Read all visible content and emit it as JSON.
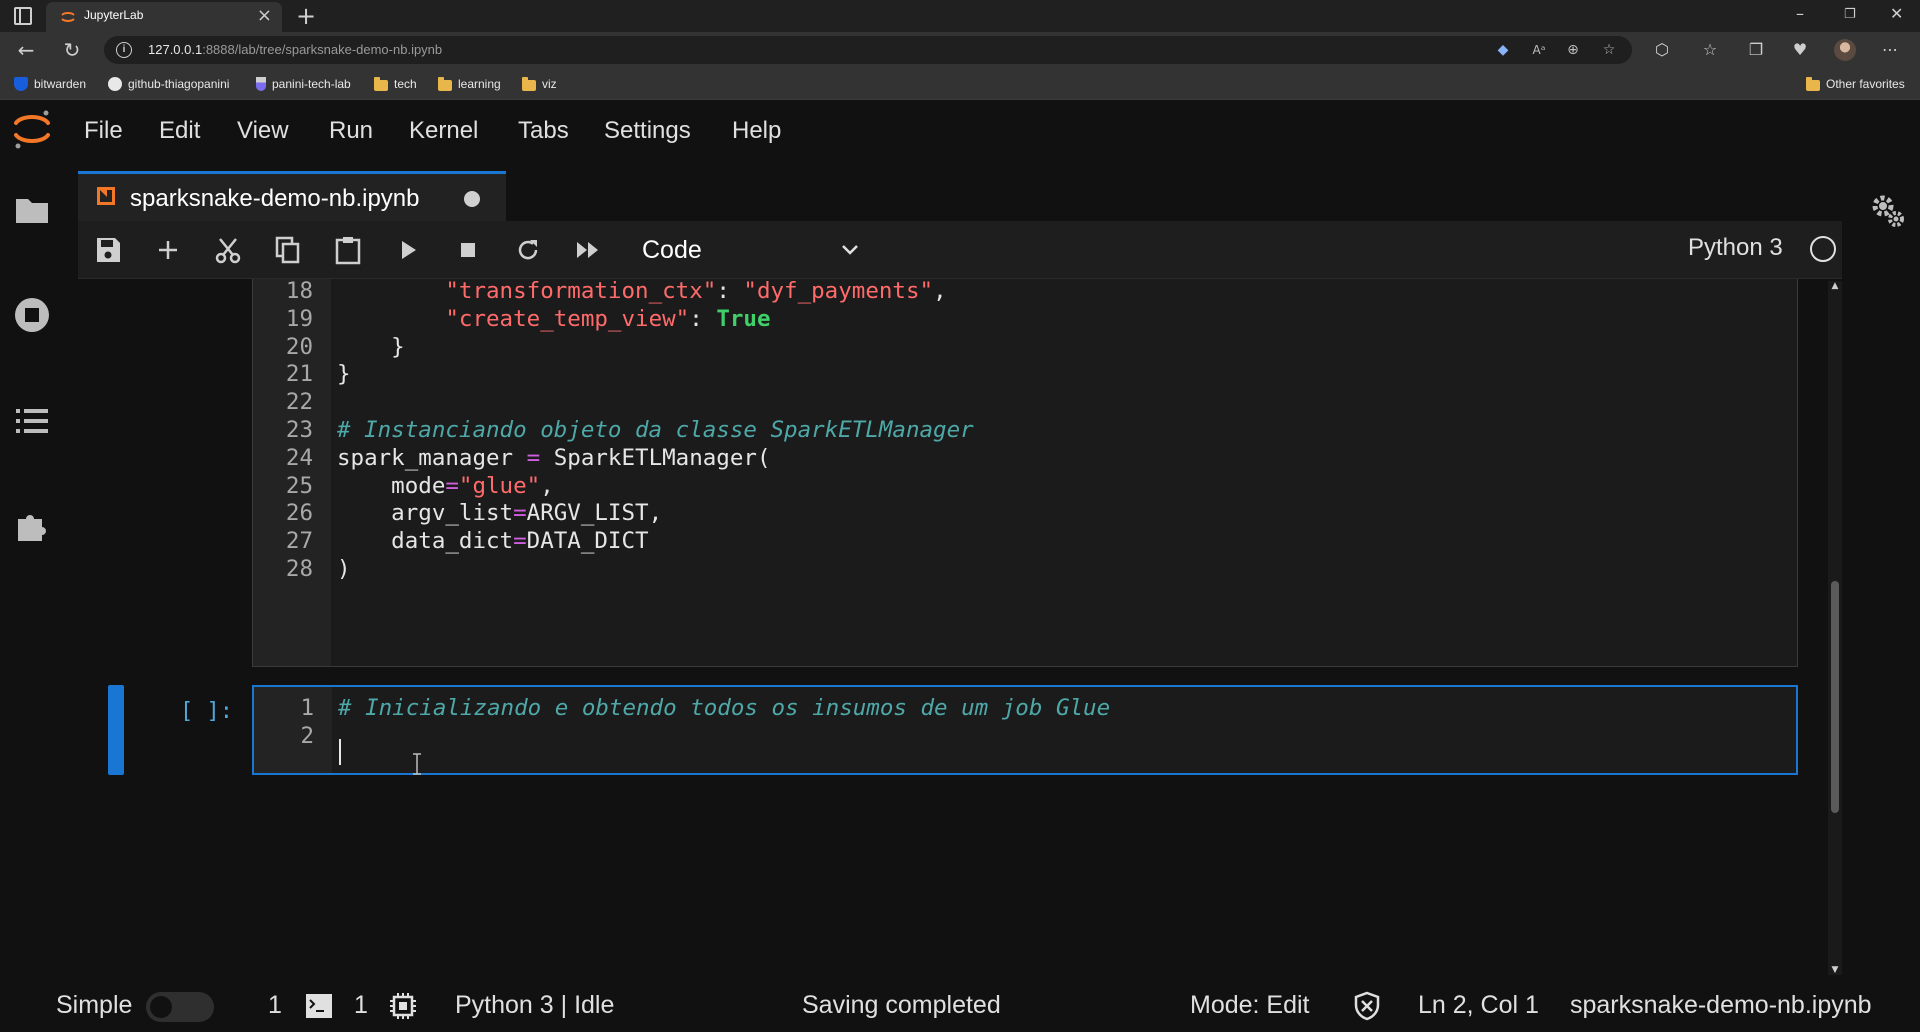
{
  "browser": {
    "tab_title": "JupyterLab",
    "url_host": "127.0.0.1",
    "url_rest": ":8888/lab/tree/sparksnake-demo-nb.ipynb",
    "bookmarks": [
      {
        "label": "bitwarden",
        "icon": "shield-icon"
      },
      {
        "label": "github-thiagopanini",
        "icon": "github-icon"
      },
      {
        "label": "panini-tech-lab",
        "icon": "flask-icon"
      },
      {
        "label": "tech",
        "icon": "folder-icon"
      },
      {
        "label": "learning",
        "icon": "folder-icon"
      },
      {
        "label": "viz",
        "icon": "folder-icon"
      }
    ],
    "other_favorites": "Other favorites"
  },
  "menu": [
    "File",
    "Edit",
    "View",
    "Run",
    "Kernel",
    "Tabs",
    "Settings",
    "Help"
  ],
  "document": {
    "tab_title": "sparksnake-demo-nb.ipynb",
    "unsaved_dot_color": "#d0d0d0"
  },
  "toolbar": {
    "cell_type": "Code",
    "kernel_name": "Python 3"
  },
  "cells": {
    "previous": {
      "lines": [
        {
          "n": "18",
          "tokens": [
            {
              "t": "        ",
              "c": "plain"
            },
            {
              "t": "\"transformation_ctx\"",
              "c": "str"
            },
            {
              "t": ": ",
              "c": "plain"
            },
            {
              "t": "\"dyf_payments\"",
              "c": "str"
            },
            {
              "t": ",",
              "c": "plain"
            }
          ]
        },
        {
          "n": "19",
          "tokens": [
            {
              "t": "        ",
              "c": "plain"
            },
            {
              "t": "\"create_temp_view\"",
              "c": "str"
            },
            {
              "t": ": ",
              "c": "plain"
            },
            {
              "t": "True",
              "c": "kw"
            }
          ]
        },
        {
          "n": "20",
          "tokens": [
            {
              "t": "    }",
              "c": "plain"
            }
          ]
        },
        {
          "n": "21",
          "tokens": [
            {
              "t": "}",
              "c": "plain"
            }
          ]
        },
        {
          "n": "22",
          "tokens": []
        },
        {
          "n": "23",
          "tokens": [
            {
              "t": "# Instanciando objeto da classe SparkETLManager",
              "c": "com"
            }
          ]
        },
        {
          "n": "24",
          "tokens": [
            {
              "t": "spark_manager ",
              "c": "plain"
            },
            {
              "t": "=",
              "c": "op"
            },
            {
              "t": " SparkETLManager(",
              "c": "plain"
            }
          ]
        },
        {
          "n": "25",
          "tokens": [
            {
              "t": "    mode",
              "c": "plain"
            },
            {
              "t": "=",
              "c": "op"
            },
            {
              "t": "\"glue\"",
              "c": "str"
            },
            {
              "t": ",",
              "c": "plain"
            }
          ]
        },
        {
          "n": "26",
          "tokens": [
            {
              "t": "    argv_list",
              "c": "plain"
            },
            {
              "t": "=",
              "c": "op"
            },
            {
              "t": "ARGV_LIST,",
              "c": "plain"
            }
          ]
        },
        {
          "n": "27",
          "tokens": [
            {
              "t": "    data_dict",
              "c": "plain"
            },
            {
              "t": "=",
              "c": "op"
            },
            {
              "t": "DATA_DICT",
              "c": "plain"
            }
          ]
        },
        {
          "n": "28",
          "tokens": [
            {
              "t": ")",
              "c": "plain"
            }
          ]
        }
      ]
    },
    "active": {
      "prompt": "[ ]:",
      "lines": [
        {
          "n": "1",
          "tokens": [
            {
              "t": "# Inicializando e obtendo todos os insumos de um job Glue",
              "c": "com"
            }
          ]
        },
        {
          "n": "2",
          "tokens": []
        }
      ]
    }
  },
  "statusbar": {
    "mode_label": "Simple",
    "terminals_count": "1",
    "kernels_count": "1",
    "kernel_status": "Python 3 | Idle",
    "save_status": "Saving completed",
    "edit_mode": "Mode: Edit",
    "cursor_position": "Ln 2, Col 1",
    "file_name": "sparksnake-demo-nb.ipynb"
  },
  "colors": {
    "accent": "#1976d2",
    "string": "#ff6b6b",
    "keyword": "#3fd06a",
    "operator": "#d05fe0",
    "comment": "#4ea8a8",
    "jupyter_orange": "#f37726"
  }
}
